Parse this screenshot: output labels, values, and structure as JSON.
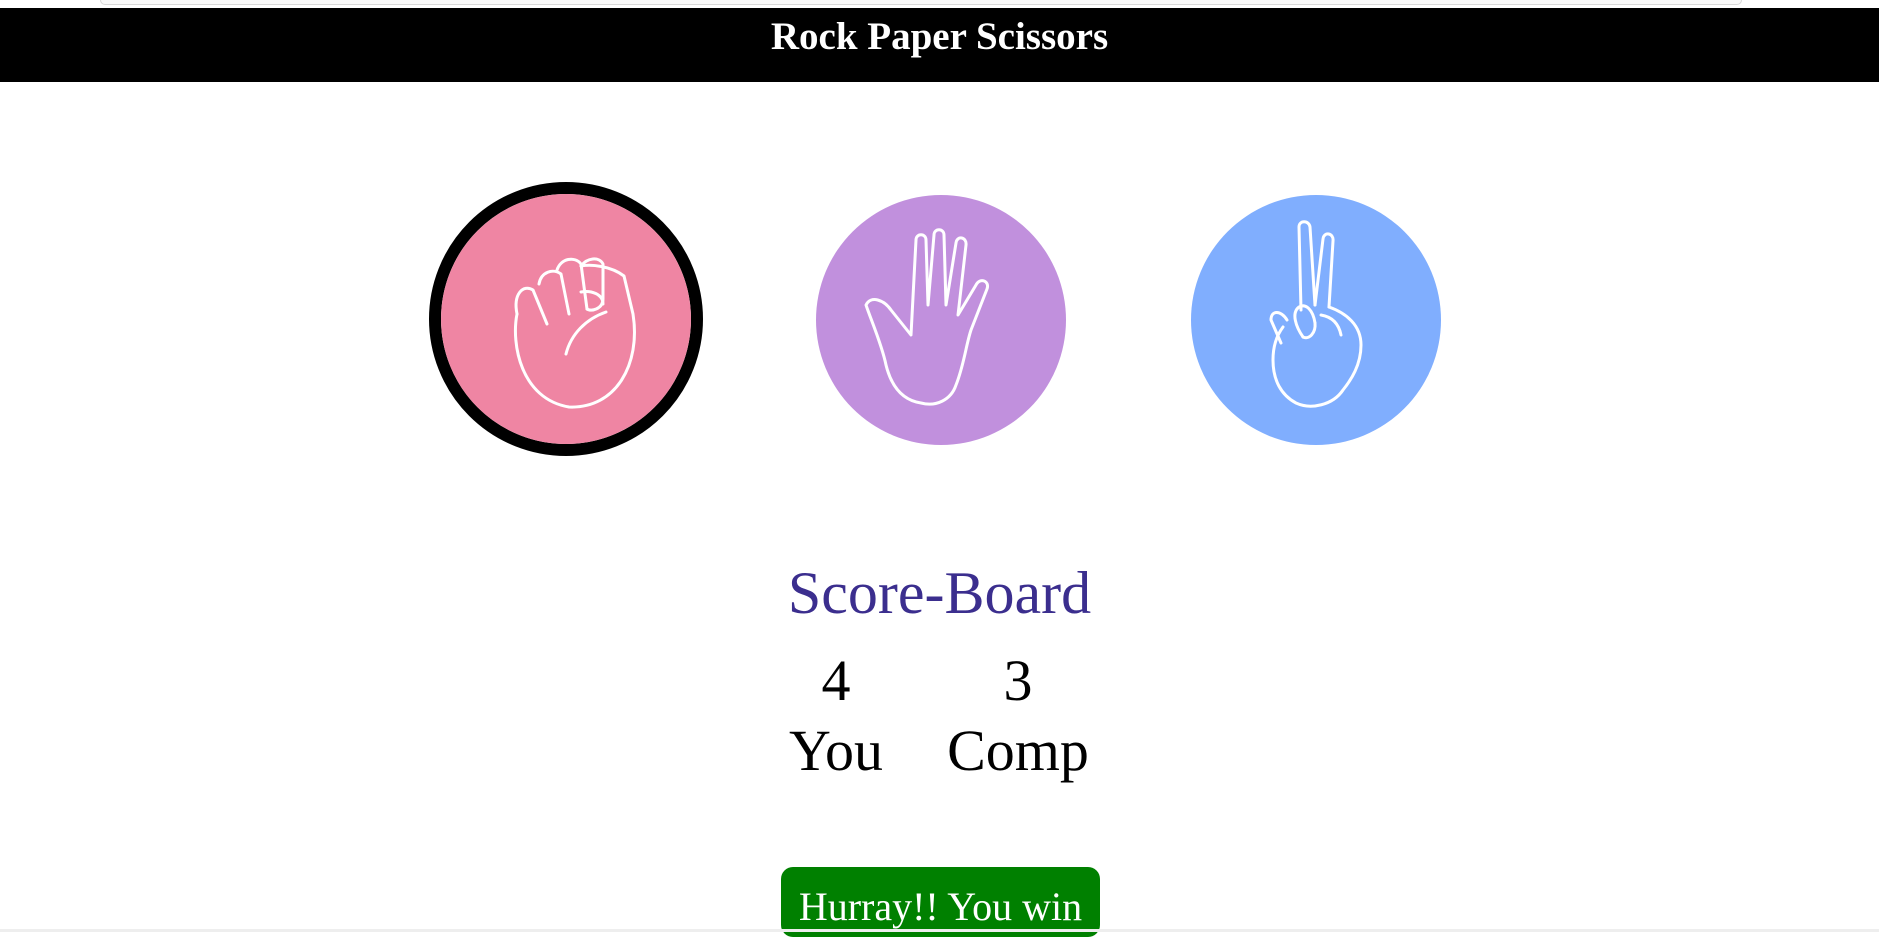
{
  "header": {
    "title": "Rock Paper Scissors"
  },
  "choices": [
    {
      "name": "rock",
      "color": "#ef85a3",
      "selected": true,
      "icon": "fist-icon"
    },
    {
      "name": "paper",
      "color": "#c190dd",
      "selected": false,
      "icon": "open-hand-icon"
    },
    {
      "name": "scissors",
      "color": "#80aefe",
      "selected": false,
      "icon": "peace-sign-icon"
    }
  ],
  "scoreboard": {
    "title": "Score-Board",
    "user_score": "4",
    "user_label": "You",
    "comp_score": "3",
    "comp_label": "Comp"
  },
  "message": {
    "text": "Hurray!! You win",
    "color": "#008000"
  }
}
